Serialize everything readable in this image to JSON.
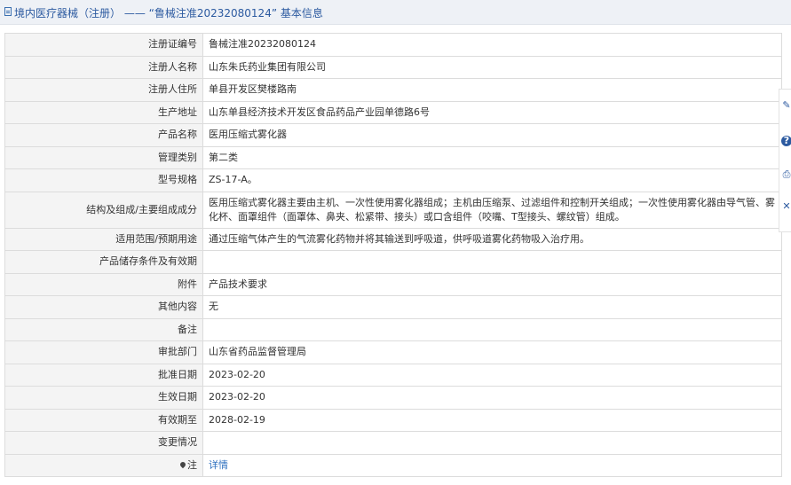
{
  "header": {
    "title": "境内医疗器械（注册） —— “鲁械注准20232080124” 基本信息"
  },
  "rows": [
    {
      "label": "注册证编号",
      "value": "鲁械注准20232080124"
    },
    {
      "label": "注册人名称",
      "value": "山东朱氏药业集团有限公司"
    },
    {
      "label": "注册人住所",
      "value": "单县开发区樊楼路南"
    },
    {
      "label": "生产地址",
      "value": "山东单县经济技术开发区食品药品产业园单德路6号"
    },
    {
      "label": "产品名称",
      "value": "医用压缩式雾化器"
    },
    {
      "label": "管理类别",
      "value": "第二类"
    },
    {
      "label": "型号规格",
      "value": "ZS-17-A。"
    },
    {
      "label": "结构及组成/主要组成成分",
      "value": "医用压缩式雾化器主要由主机、一次性使用雾化器组成；主机由压缩泵、过滤组件和控制开关组成；一次性使用雾化器由导气管、雾化杯、面罩组件（面罩体、鼻夹、松紧带、接头）或口含组件（咬嘴、T型接头、螺纹管）组成。"
    },
    {
      "label": "适用范围/预期用途",
      "value": "通过压缩气体产生的气流雾化药物并将其输送到呼吸道，供呼吸道雾化药物吸入治疗用。"
    },
    {
      "label": "产品储存条件及有效期",
      "value": ""
    },
    {
      "label": "附件",
      "value": "产品技术要求"
    },
    {
      "label": "其他内容",
      "value": "无"
    },
    {
      "label": "备注",
      "value": ""
    },
    {
      "label": "审批部门",
      "value": "山东省药品监督管理局"
    },
    {
      "label": "批准日期",
      "value": "2023-02-20"
    },
    {
      "label": "生效日期",
      "value": "2023-02-20"
    },
    {
      "label": "有效期至",
      "value": "2028-02-19"
    },
    {
      "label": "变更情况",
      "value": ""
    },
    {
      "label": "注",
      "value": "详情"
    }
  ],
  "sidetool": {
    "edit": "✎",
    "help": "?",
    "print": "⎙",
    "close": "✕"
  },
  "colors": {
    "link": "#2c6fbf",
    "header_bg": "#eef1f6",
    "header_text": "#2c5aa0",
    "label_bg": "#f4f4f4",
    "border": "#dcdcdc"
  }
}
